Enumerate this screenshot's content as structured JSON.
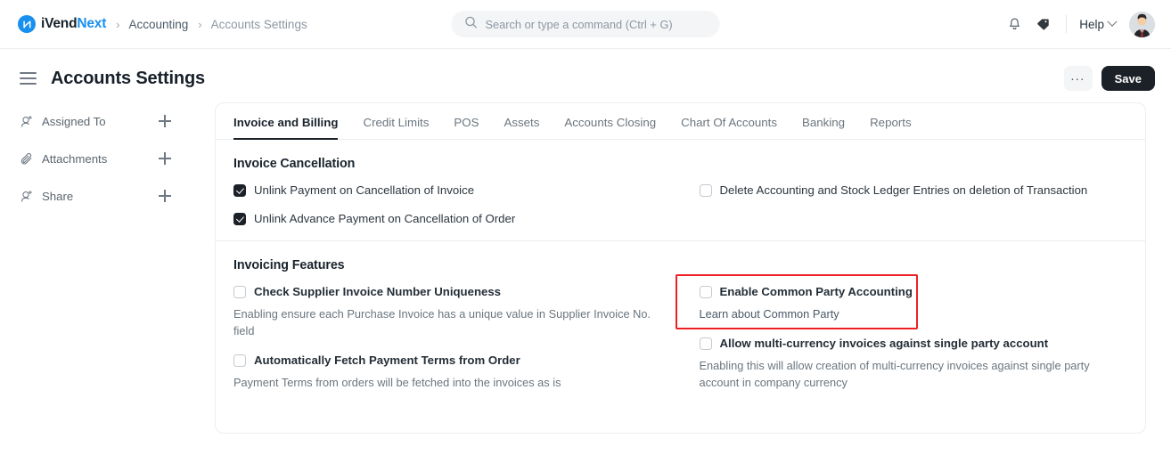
{
  "navbar": {
    "brand_first": "iVend",
    "brand_second": "Next",
    "logo_icon": "ivend-logo-icon",
    "breadcrumbs": [
      {
        "label": "Accounting",
        "muted": false
      },
      {
        "label": "Accounts Settings",
        "muted": true
      }
    ],
    "separator": "›",
    "search": {
      "placeholder": "Search or type a command (Ctrl + G)",
      "value": "",
      "icon": "search-icon"
    },
    "notification_icon": "bell-icon",
    "tag_icon": "tag-icon",
    "help_label": "Help",
    "help_chevron_icon": "chevron-down-icon",
    "avatar_icon": "user-avatar"
  },
  "page": {
    "menu_icon": "hamburger-menu-icon",
    "title": "Accounts Settings",
    "more_label": "...",
    "save_label": "Save"
  },
  "sidebar": {
    "items": [
      {
        "label": "Assigned To",
        "icon": "user-add-icon",
        "add_icon": "plus-icon"
      },
      {
        "label": "Attachments",
        "icon": "paperclip-icon",
        "add_icon": "plus-icon"
      },
      {
        "label": "Share",
        "icon": "user-add-icon",
        "add_icon": "plus-icon"
      }
    ]
  },
  "tabs": [
    {
      "label": "Invoice and Billing",
      "active": true
    },
    {
      "label": "Credit Limits",
      "active": false
    },
    {
      "label": "POS",
      "active": false
    },
    {
      "label": "Assets",
      "active": false
    },
    {
      "label": "Accounts Closing",
      "active": false
    },
    {
      "label": "Chart Of Accounts",
      "active": false
    },
    {
      "label": "Banking",
      "active": false
    },
    {
      "label": "Reports",
      "active": false
    }
  ],
  "sections": {
    "invoice_cancellation": {
      "title": "Invoice Cancellation",
      "left": [
        {
          "label": "Unlink Payment on Cancellation of Invoice",
          "checked": true
        },
        {
          "label": "Unlink Advance Payment on Cancellation of Order",
          "checked": true
        }
      ],
      "right": [
        {
          "label": "Delete Accounting and Stock Ledger Entries on deletion of Transaction",
          "checked": false
        }
      ]
    },
    "invoicing_features": {
      "title": "Invoicing Features",
      "left": [
        {
          "label": "Check Supplier Invoice Number Uniqueness",
          "checked": false,
          "help": "Enabling ensure each Purchase Invoice has a unique value in Supplier Invoice No. field"
        },
        {
          "label": "Automatically Fetch Payment Terms from Order",
          "checked": false,
          "help": "Payment Terms from orders will be fetched into the invoices as is"
        }
      ],
      "right": [
        {
          "label": "Enable Common Party Accounting",
          "checked": false,
          "link": "Learn about Common Party",
          "highlighted": true
        },
        {
          "label": "Allow multi-currency invoices against single party account",
          "checked": false,
          "help": "Enabling this will allow creation of multi-currency invoices against single party account in company currency"
        }
      ]
    }
  },
  "colors": {
    "accent": "#1890f0",
    "dark": "#1c2127",
    "highlight": "#ee2024",
    "border": "#ebeef0",
    "muted_text": "#6b767f"
  }
}
